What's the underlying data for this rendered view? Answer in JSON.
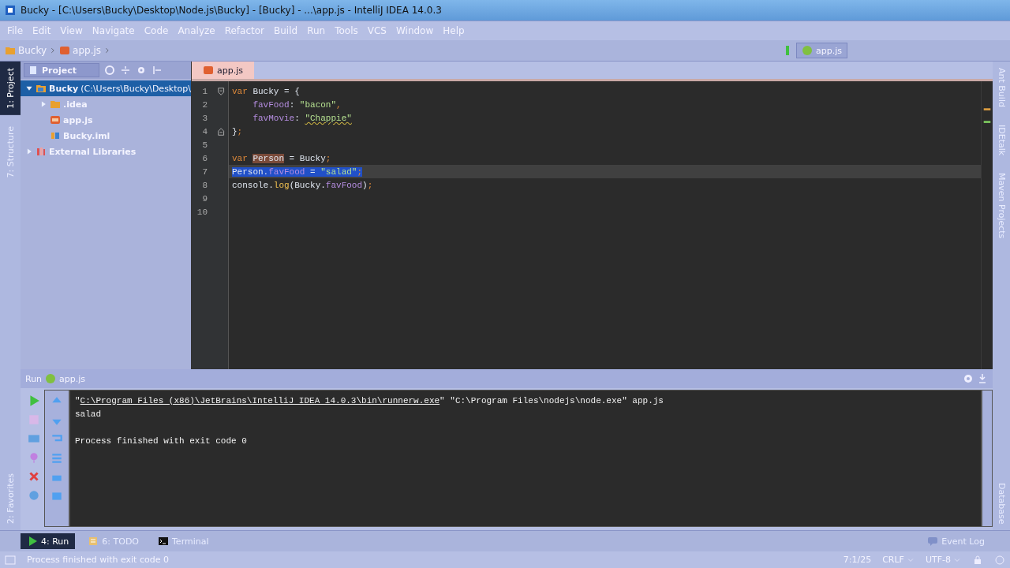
{
  "window": {
    "title": "Bucky - [C:\\Users\\Bucky\\Desktop\\Node.js\\Bucky] - [Bucky] - ...\\app.js - IntelliJ IDEA 14.0.3"
  },
  "menu": [
    "File",
    "Edit",
    "View",
    "Navigate",
    "Code",
    "Analyze",
    "Refactor",
    "Build",
    "Run",
    "Tools",
    "VCS",
    "Window",
    "Help"
  ],
  "breadcrumbs": [
    "Bucky",
    "app.js"
  ],
  "run_config": {
    "label": "app.js"
  },
  "left_stripe": {
    "top": [
      {
        "label": "1: Project",
        "selected": true
      },
      {
        "label": "7: Structure",
        "selected": false
      }
    ],
    "bottom": [
      {
        "label": "2: Favorites",
        "selected": false
      }
    ]
  },
  "right_stripe": {
    "top": [
      {
        "label": "Ant Build"
      },
      {
        "label": "IDEtalk"
      },
      {
        "label": "Maven Projects"
      }
    ],
    "bottom": [
      {
        "label": "Database"
      }
    ]
  },
  "project": {
    "view": "Project",
    "tree": [
      {
        "label": "Bucky",
        "detail": "(C:\\Users\\Bucky\\Desktop\\",
        "kind": "module",
        "expanded": true,
        "selected": true,
        "children": [
          {
            "label": ".idea",
            "kind": "folder",
            "expanded": false,
            "selected": false
          },
          {
            "label": "app.js",
            "kind": "js",
            "selected": false
          },
          {
            "label": "Bucky.iml",
            "kind": "iml",
            "selected": false
          }
        ]
      },
      {
        "label": "External Libraries",
        "kind": "library",
        "expanded": false,
        "selected": false
      }
    ]
  },
  "editor": {
    "tab": {
      "label": "app.js",
      "selected": true
    },
    "lines": [
      {
        "number": "1",
        "kind": "fold_start",
        "current": false,
        "selected": false,
        "tokens": [
          {
            "text": "var",
            "kind": "keyword"
          },
          {
            "text": " Bucky = {",
            "kind": "plain"
          }
        ]
      },
      {
        "number": "2",
        "kind": "plain",
        "current": false,
        "selected": false,
        "tokens": [
          {
            "text": "    favFood",
            "kind": "property"
          },
          {
            "text": ": ",
            "kind": "plain"
          },
          {
            "text": "\"bacon\"",
            "kind": "string"
          },
          {
            "text": ",",
            "kind": "keyword"
          }
        ]
      },
      {
        "number": "3",
        "kind": "plain",
        "current": false,
        "selected": false,
        "tokens": [
          {
            "text": "    favMovie",
            "kind": "property"
          },
          {
            "text": ": ",
            "kind": "plain"
          },
          {
            "text": "\"Chappie\"",
            "kind": "string",
            "typo": true
          }
        ]
      },
      {
        "number": "4",
        "kind": "fold_end",
        "current": false,
        "selected": false,
        "tokens": [
          {
            "text": "}",
            "kind": "plain"
          },
          {
            "text": ";",
            "kind": "keyword"
          }
        ]
      },
      {
        "number": "5",
        "kind": "plain",
        "current": false,
        "selected": false
      },
      {
        "number": "6",
        "kind": "plain",
        "current": false,
        "selected": false,
        "tokens": [
          {
            "text": "var ",
            "kind": "keyword"
          },
          {
            "text": "Person",
            "kind": "usage"
          },
          {
            "text": " = Bucky",
            "kind": "plain"
          },
          {
            "text": ";",
            "kind": "keyword"
          }
        ]
      },
      {
        "number": "7",
        "kind": "plain",
        "current": true,
        "selected": true,
        "tokens": [
          {
            "text": "Person.",
            "kind": "plain"
          },
          {
            "text": "favFood",
            "kind": "property"
          },
          {
            "text": " = ",
            "kind": "plain"
          },
          {
            "text": "\"salad\"",
            "kind": "string"
          },
          {
            "text": ";",
            "kind": "keyword"
          }
        ]
      },
      {
        "number": "8",
        "kind": "plain",
        "current": false,
        "selected": false,
        "tokens": [
          {
            "text": "console.",
            "kind": "plain"
          },
          {
            "text": "log",
            "kind": "method"
          },
          {
            "text": "(Bucky.",
            "kind": "plain"
          },
          {
            "text": "favFood",
            "kind": "property"
          },
          {
            "text": ")",
            "kind": "plain"
          },
          {
            "text": ";",
            "kind": "keyword"
          }
        ]
      },
      {
        "number": "9",
        "kind": "plain",
        "current": false,
        "selected": false
      },
      {
        "number": "10",
        "kind": "plain",
        "current": false,
        "selected": false
      }
    ]
  },
  "run": {
    "title": "Run",
    "config": "app.js",
    "console": [
      {
        "tokens": [
          {
            "text": "\"",
            "kind": "plain"
          },
          {
            "text": "C:\\Program Files (x86)\\JetBrains\\IntelliJ IDEA 14.0.3\\bin\\runnerw.exe",
            "kind": "link"
          },
          {
            "text": "\" \"C:\\Program Files\\nodejs\\node.exe\" app.js",
            "kind": "plain"
          }
        ]
      },
      {
        "tokens": [
          {
            "text": "salad",
            "kind": "plain"
          }
        ]
      },
      {
        "blank_before": true,
        "tokens": [
          {
            "text": "Process finished with exit code 0",
            "kind": "plain"
          }
        ]
      }
    ]
  },
  "bottom_tabs": [
    {
      "label": "4: Run",
      "kind": "run",
      "selected": true
    },
    {
      "label": "6: TODO",
      "kind": "todo",
      "selected": false
    },
    {
      "label": "Terminal",
      "kind": "terminal",
      "selected": false
    }
  ],
  "event_log": "Event Log",
  "status": {
    "message": "Process finished with exit code 0",
    "position": "7:1/25",
    "line_separator": "CRLF",
    "encoding": "UTF-8"
  }
}
